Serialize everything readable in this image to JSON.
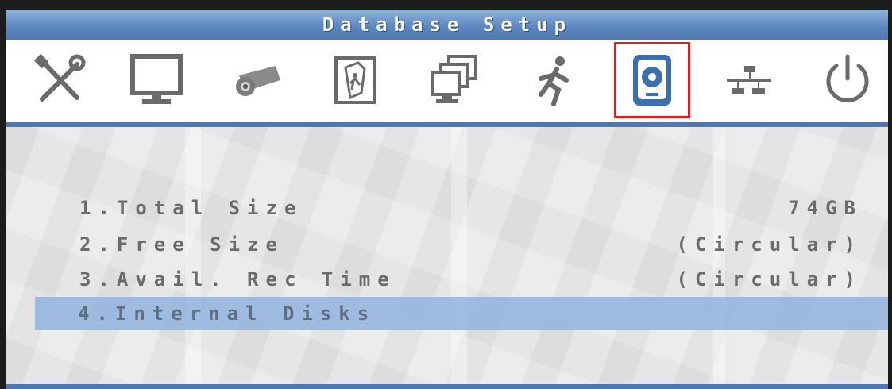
{
  "title": "Database Setup",
  "toolbar": {
    "icons": [
      {
        "name": "tools-icon",
        "color": "#6a6a6a"
      },
      {
        "name": "monitor-icon",
        "color": "#6a6a6a"
      },
      {
        "name": "camera-icon",
        "color": "#6a6a6a"
      },
      {
        "name": "event-icon",
        "color": "#6a6a6a"
      },
      {
        "name": "windows-icon",
        "color": "#6a6a6a"
      },
      {
        "name": "motion-icon",
        "color": "#6a6a6a"
      },
      {
        "name": "database-icon",
        "color": "#3a6fb0",
        "selected": true
      },
      {
        "name": "network-icon",
        "color": "#6a6a6a"
      },
      {
        "name": "power-icon",
        "color": "#6a6a6a"
      }
    ]
  },
  "menu": {
    "items": [
      {
        "label": "1.Total Size",
        "value": "74GB"
      },
      {
        "label": "2.Free Size",
        "value": "(Circular)"
      },
      {
        "label": "3.Avail. Rec Time",
        "value": "(Circular)"
      },
      {
        "label": "4.Internal Disks",
        "value": "",
        "highlighted": true
      }
    ]
  },
  "colors": {
    "accent_blue": "#4d79b3",
    "highlight": "#91b4de",
    "selection_outline": "#e21d1d",
    "text_gray": "#6b6b6b"
  }
}
